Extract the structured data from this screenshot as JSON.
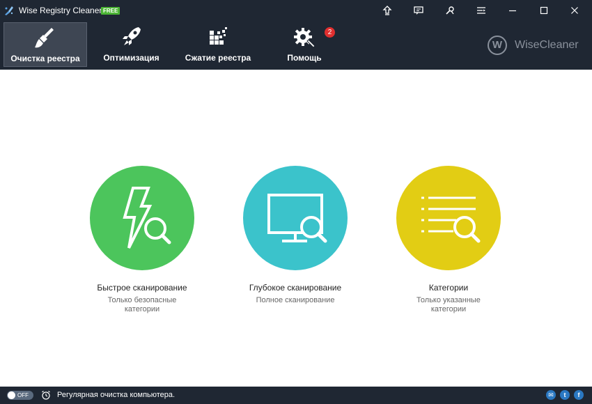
{
  "window": {
    "title": "Wise Registry Cleaner 9",
    "badge": "FREE"
  },
  "titlebar_buttons": [
    {
      "name": "upgrade-icon"
    },
    {
      "name": "feedback-icon"
    },
    {
      "name": "tools-icon"
    },
    {
      "name": "menu-icon"
    },
    {
      "name": "minimize-icon"
    },
    {
      "name": "maximize-icon"
    },
    {
      "name": "close-icon"
    }
  ],
  "toolbar": {
    "items": [
      {
        "label": "Очистка реестра",
        "icon": "broom-icon",
        "active": true
      },
      {
        "label": "Оптимизация",
        "icon": "rocket-icon",
        "active": false
      },
      {
        "label": "Сжатие реестра",
        "icon": "compress-icon",
        "active": false
      },
      {
        "label": "Помощь",
        "icon": "gear-wrench-icon",
        "active": false,
        "badge": "2"
      }
    ],
    "brand": {
      "letter": "W",
      "name": "WiseCleaner"
    }
  },
  "scans": [
    {
      "title": "Быстрое сканирование",
      "subtitle": "Только безопасные категории",
      "color": "#4cc55c",
      "icon": "bolt-search-icon"
    },
    {
      "title": "Глубокое сканирование",
      "subtitle": "Полное сканирование",
      "color": "#3bc3cb",
      "icon": "monitor-search-icon"
    },
    {
      "title": "Категории",
      "subtitle": "Только указанные категории",
      "color": "#e2cd14",
      "icon": "list-search-icon"
    }
  ],
  "statusbar": {
    "toggle_label": "OFF",
    "text": "Регулярная очистка компьютера.",
    "social": [
      {
        "name": "email-icon",
        "glyph": "✉"
      },
      {
        "name": "twitter-icon",
        "glyph": "t"
      },
      {
        "name": "facebook-icon",
        "glyph": "f"
      }
    ]
  }
}
